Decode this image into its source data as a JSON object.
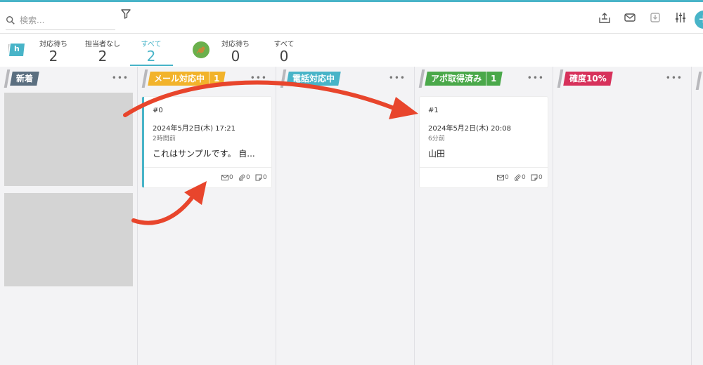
{
  "search": {
    "placeholder": "検索..."
  },
  "tabs": {
    "inbox_letter": "h",
    "items": [
      {
        "label": "対応待ち",
        "count": "2"
      },
      {
        "label": "担当者なし",
        "count": "2"
      },
      {
        "label": "すべて",
        "count": "2",
        "active": true
      },
      {
        "label": "対応待ち",
        "count": "0"
      },
      {
        "label": "すべて",
        "count": "0"
      }
    ]
  },
  "columns": [
    {
      "name": "新着",
      "color": "#5b6f80",
      "count": ""
    },
    {
      "name": "メール対応中",
      "color": "#f2b32b",
      "count": "1"
    },
    {
      "name": "電話対応中",
      "color": "#48b4c8",
      "count": ""
    },
    {
      "name": "アポ取得済み",
      "color": "#4aa84a",
      "count": "1"
    },
    {
      "name": "確度10%",
      "color": "#d7315b",
      "count": ""
    }
  ],
  "cards": [
    {
      "id": "#0",
      "date": "2024年5月2日(木) 17:21",
      "relative": "2時間前",
      "text": "これはサンプルです。 自...",
      "mail": "0",
      "attach": "0",
      "note": "0"
    },
    {
      "id": "#1",
      "date": "2024年5月2日(木) 20:08",
      "relative": "6分前",
      "text": "山田",
      "mail": "0",
      "attach": "0",
      "note": "0"
    }
  ],
  "colors": {
    "accent": "#48b4c8",
    "arrow": "#e8452c"
  },
  "icons": [
    "search-icon",
    "filter-icon",
    "export-icon",
    "mail-icon",
    "download-icon",
    "settings-sliders-icon",
    "add-icon"
  ]
}
